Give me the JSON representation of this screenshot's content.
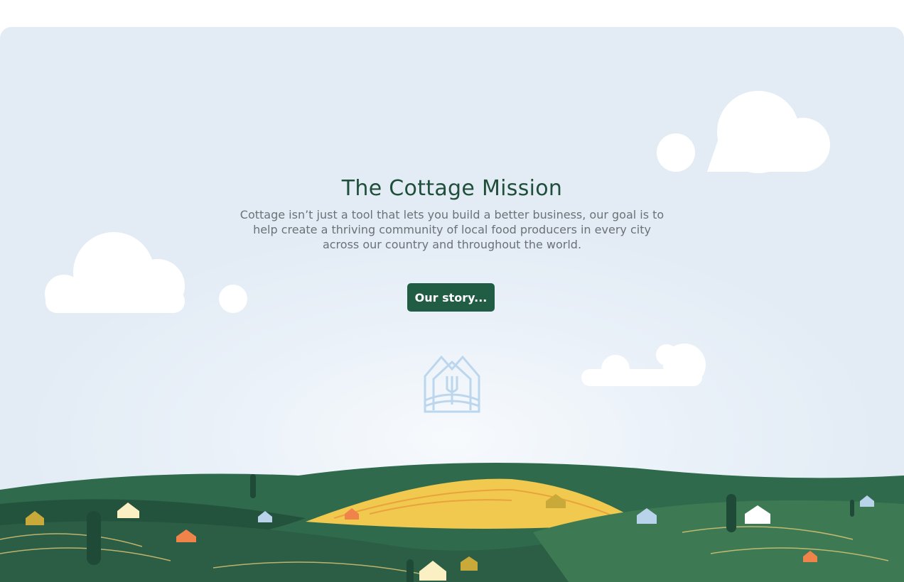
{
  "hero": {
    "title": "The Cottage Mission",
    "description": "Cottage isn’t just a tool that lets you build a better business, our goal is to help create a thriving community of local food producers in every city across our country and throughout the world.",
    "cta_label": "Our story...",
    "logo_icon": "house-fork-logo-icon"
  },
  "colors": {
    "brand_green": "#215c45",
    "title_green": "#1f4f3a",
    "sky": "#e3ecf5",
    "logo_blue": "#bcd6ee"
  }
}
